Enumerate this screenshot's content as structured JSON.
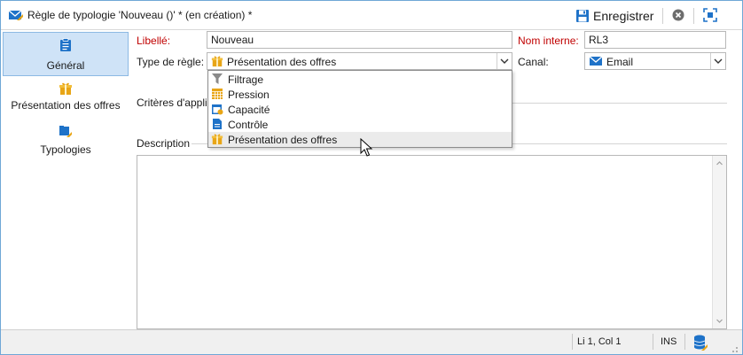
{
  "window": {
    "title": "Règle de typologie 'Nouveau ()' * (en création) *",
    "save_label": "Enregistrer"
  },
  "sidebar": {
    "items": [
      {
        "label": "Général",
        "icon": "clipboard-icon",
        "active": true
      },
      {
        "label": "Présentation des offres",
        "icon": "gift-icon",
        "active": false
      },
      {
        "label": "Typologies",
        "icon": "typology-icon",
        "active": false
      }
    ]
  },
  "form": {
    "libelle_label": "Libellé:",
    "libelle_value": "Nouveau",
    "nom_interne_label": "Nom interne:",
    "nom_interne_value": "RL3",
    "type_regle_label": "Type de règle:",
    "type_regle_value": "Présentation des offres",
    "canal_label": "Canal:",
    "canal_value": "Email",
    "criteres_label": "Critères d'appli",
    "description_label": "Description"
  },
  "dropdown": {
    "items": [
      {
        "label": "Filtrage",
        "icon": "funnel-icon"
      },
      {
        "label": "Pression",
        "icon": "calendar-grid-icon"
      },
      {
        "label": "Capacité",
        "icon": "calendar-clock-icon"
      },
      {
        "label": "Contrôle",
        "icon": "document-icon"
      },
      {
        "label": "Présentation des offres",
        "icon": "gift-icon"
      }
    ],
    "highlighted": "Présentation des offres"
  },
  "statusbar": {
    "position": "Li 1, Col 1",
    "mode": "INS"
  },
  "colors": {
    "accent": "#1e72c8",
    "required_label": "#c00000",
    "active_tab_bg": "#cfe3f7",
    "gift": "#e8a516"
  }
}
